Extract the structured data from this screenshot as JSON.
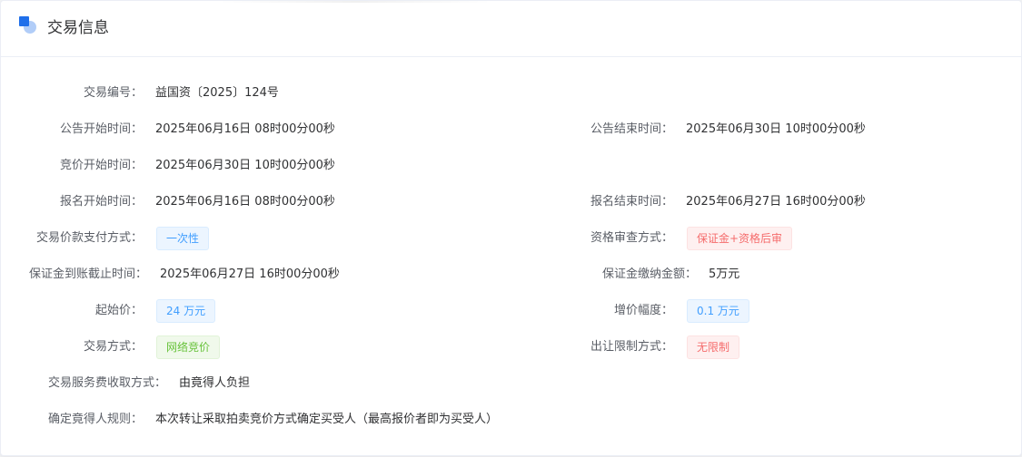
{
  "header": {
    "title": "交易信息",
    "icon": "info-section-icon"
  },
  "fields": {
    "trade_no": {
      "label": "交易编号：",
      "value": "益国资〔2025〕124号"
    },
    "notice_start": {
      "label": "公告开始时间：",
      "value": "2025年06月16日 08时00分00秒"
    },
    "notice_end": {
      "label": "公告结束时间：",
      "value": "2025年06月30日 10时00分00秒"
    },
    "bid_start": {
      "label": "竞价开始时间：",
      "value": "2025年06月30日 10时00分00秒"
    },
    "signup_start": {
      "label": "报名开始时间：",
      "value": "2025年06月16日 08时00分00秒"
    },
    "signup_end": {
      "label": "报名结束时间：",
      "value": "2025年06月27日 16时00分00秒"
    },
    "payment_method": {
      "label": "交易价款支付方式：",
      "value": "一次性"
    },
    "qualification_review": {
      "label": "资格审查方式：",
      "value": "保证金+资格后审"
    },
    "deposit_deadline": {
      "label": "保证金到账截止时间：",
      "value": "2025年06月27日 16时00分00秒"
    },
    "deposit_amount": {
      "label": "保证金缴纳金额：",
      "value": "5万元"
    },
    "starting_price": {
      "label": "起始价：",
      "value": "24 万元"
    },
    "increment": {
      "label": "增价幅度：",
      "value": "0.1 万元"
    },
    "trade_method": {
      "label": "交易方式：",
      "value": "网络竞价"
    },
    "transfer_restriction": {
      "label": "出让限制方式：",
      "value": "无限制"
    },
    "service_fee": {
      "label": "交易服务费收取方式：",
      "value": "由竟得人负担"
    },
    "winner_rule": {
      "label": "确定竟得人规则：",
      "value": "本次转让采取拍卖竞价方式确定买受人（最高报价者即为买受人）"
    }
  },
  "colors": {
    "tag_blue": "#409eff",
    "tag_red": "#f56c6c",
    "tag_green": "#67c23a",
    "icon_primary": "#1f6fea"
  }
}
